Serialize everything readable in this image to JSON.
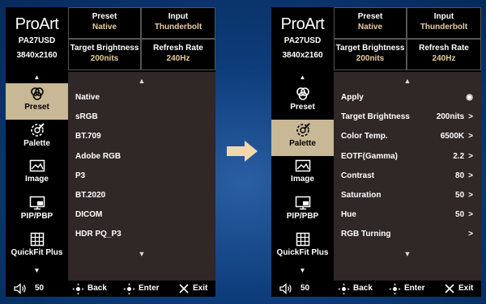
{
  "colors": {
    "accent": "#e8cda1",
    "active_bg": "#c8b896",
    "panel_bg": "#302727",
    "arrow": "#f2d9ad"
  },
  "screens": [
    {
      "logo": {
        "brand": "ProArt",
        "model": "PA27USD",
        "resolution": "3840x2160"
      },
      "header": {
        "preset_label": "Preset",
        "preset_value": "Native",
        "input_label": "Input",
        "input_value": "Thunderbolt",
        "brightness_label": "Target Brightness",
        "brightness_value": "200nits",
        "refresh_label": "Refresh Rate",
        "refresh_value": "240Hz"
      },
      "sidebar": [
        {
          "label": "Preset",
          "icon": "preset-icon"
        },
        {
          "label": "Palette",
          "icon": "palette-icon"
        },
        {
          "label": "Image",
          "icon": "image-icon"
        },
        {
          "label": "PIP/PBP",
          "icon": "pip-icon"
        },
        {
          "label": "QuickFit Plus",
          "icon": "quickfit-icon"
        }
      ],
      "menu": [
        {
          "label": "Native"
        },
        {
          "label": "sRGB"
        },
        {
          "label": "BT.709"
        },
        {
          "label": "Adobe RGB"
        },
        {
          "label": "P3"
        },
        {
          "label": "BT.2020"
        },
        {
          "label": "DICOM"
        },
        {
          "label": "HDR PQ_P3"
        }
      ],
      "footer": {
        "volume": "50",
        "back": "Back",
        "enter": "Enter",
        "exit": "Exit"
      }
    },
    {
      "logo": {
        "brand": "ProArt",
        "model": "PA27USD",
        "resolution": "3840x2160"
      },
      "header": {
        "preset_label": "Preset",
        "preset_value": "Native",
        "input_label": "Input",
        "input_value": "Thunderbolt",
        "brightness_label": "Target Brightness",
        "brightness_value": "200nits",
        "refresh_label": "Refresh Rate",
        "refresh_value": "240Hz"
      },
      "sidebar": [
        {
          "label": "Preset",
          "icon": "preset-icon"
        },
        {
          "label": "Palette",
          "icon": "palette-icon"
        },
        {
          "label": "Image",
          "icon": "image-icon"
        },
        {
          "label": "PIP/PBP",
          "icon": "pip-icon"
        },
        {
          "label": "QuickFit Plus",
          "icon": "quickfit-icon"
        }
      ],
      "menu": [
        {
          "label": "Apply",
          "value": "◉"
        },
        {
          "label": "Target Brightness",
          "value": "200nits"
        },
        {
          "label": "Color Temp.",
          "value": "6500K"
        },
        {
          "label": "EOTF(Gamma)",
          "value": "2.2"
        },
        {
          "label": "Contrast",
          "value": "80"
        },
        {
          "label": "Saturation",
          "value": "50"
        },
        {
          "label": "Hue",
          "value": "50"
        },
        {
          "label": "RGB Turning",
          "value": ""
        }
      ],
      "footer": {
        "volume": "50",
        "back": "Back",
        "enter": "Enter",
        "exit": "Exit"
      }
    }
  ]
}
